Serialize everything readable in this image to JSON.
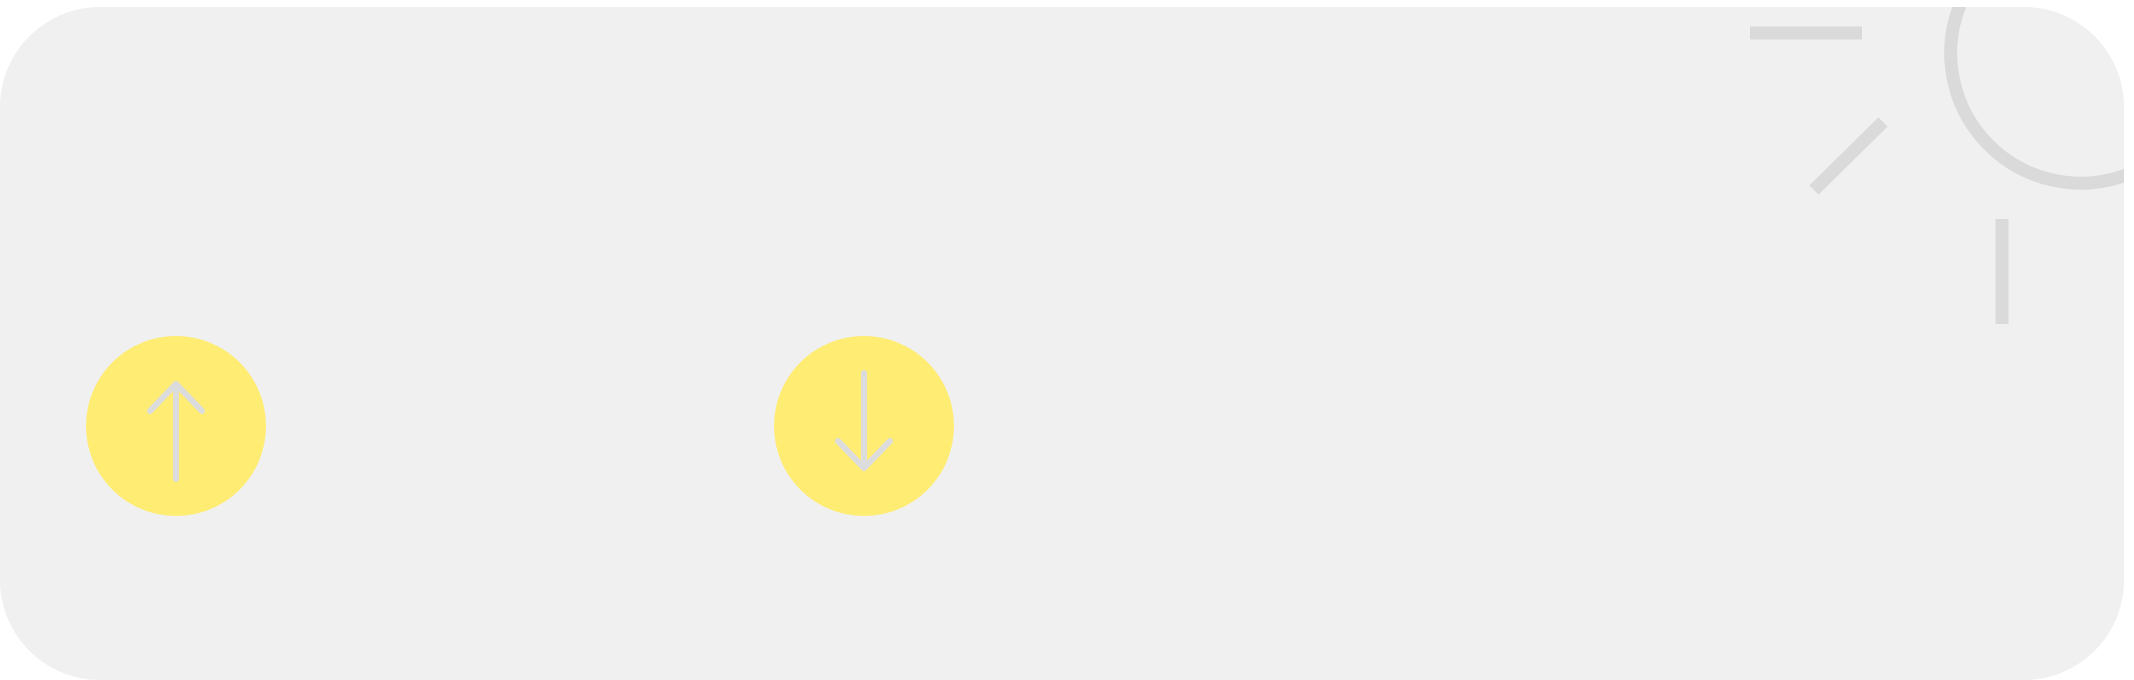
{
  "colors": {
    "card_background": "#f0f0f0",
    "button_fill": "#ffec73",
    "arrow_stroke": "#dcdcdc",
    "decoration_stroke": "#dadada"
  },
  "buttons": [
    {
      "name": "arrow-up-button",
      "icon": "arrow-up-icon"
    },
    {
      "name": "arrow-down-button",
      "icon": "arrow-down-icon"
    }
  ],
  "decoration": {
    "icon": "sun-outline-icon"
  }
}
